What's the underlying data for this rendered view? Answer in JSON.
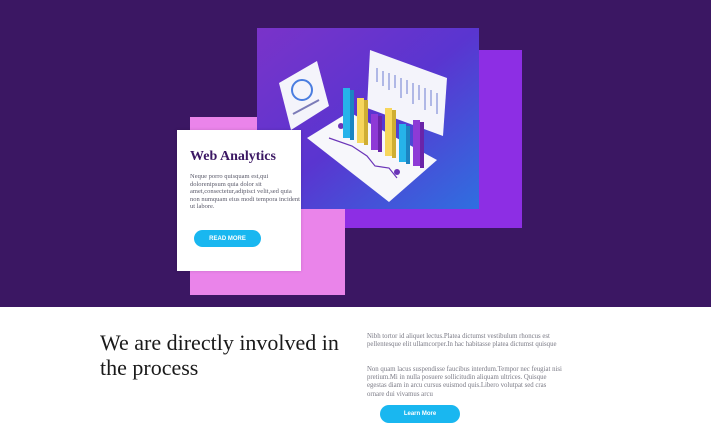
{
  "colors": {
    "hero_background": "#3b1763",
    "accent_purple": "#8d2ee4",
    "accent_pink": "#ea84ea",
    "button_blue": "#19b7f0"
  },
  "card": {
    "title": "Web Analytics",
    "text": "Neque porro quisquam est,qui dolorenipsum quia dolor sit amet,consectetur,adipisci velit,sed quia non numquam eius modi tempora incident ut labore.",
    "button_label": "READ MORE"
  },
  "intro": {
    "heading": "We are directly involved in the process",
    "paragraph_1": "Nibh tortor id aliquet lectus.Platea dictumst vestibulum rhoncus est pellentesque elit ullamcorper.In hac habitasse platea dictumst quisque",
    "paragraph_2": "Non quam lacus suspendisse faucibus interdum.Tempor nec feugiat nisi pretium.Mi in nulla posuere sollicitudin aliquam ultrices. Quisque egestas diam in arcu cursus euismod quis.Libero volutpat sed cras ornare dui vivamus arcu",
    "button_label": "Learn More"
  }
}
